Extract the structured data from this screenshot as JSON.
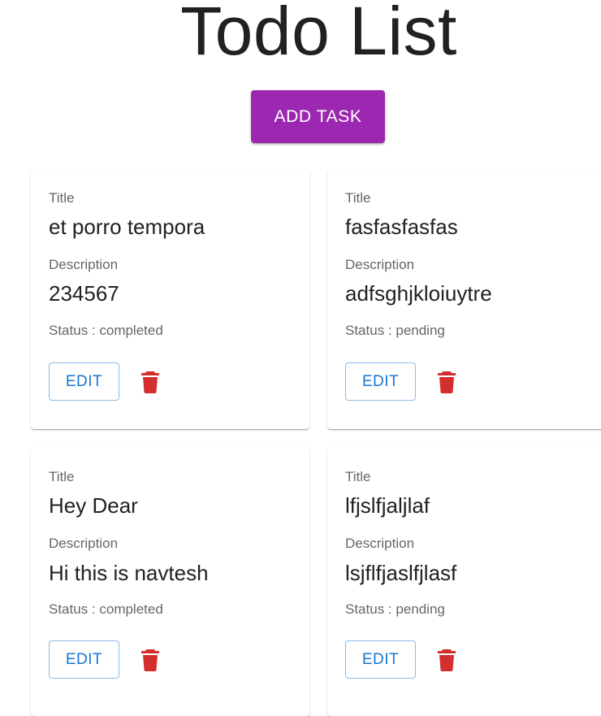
{
  "header": {
    "title": "Todo List"
  },
  "toolbar": {
    "add_label": "ADD TASK"
  },
  "labels": {
    "title": "Title",
    "description": "Description",
    "status_prefix": "Status : ",
    "edit": "EDIT"
  },
  "colors": {
    "primary": "#9c27b0",
    "edit": "#1976d2",
    "delete": "#d32f2f"
  },
  "icons": {
    "delete": "delete-icon"
  },
  "tasks": [
    {
      "title": "et porro tempora",
      "description": "234567",
      "status": "Status : completed"
    },
    {
      "title": "fasfasfasfas",
      "description": "adfsghjkloiuytre",
      "status": "Status : pending"
    },
    {
      "title": "Hey Dear",
      "description": "Hi this is navtesh",
      "status": "Status : completed"
    },
    {
      "title": "lfjslfjaljlaf",
      "description": "lsjflfjaslfjlasf",
      "status": "Status : pending"
    }
  ]
}
